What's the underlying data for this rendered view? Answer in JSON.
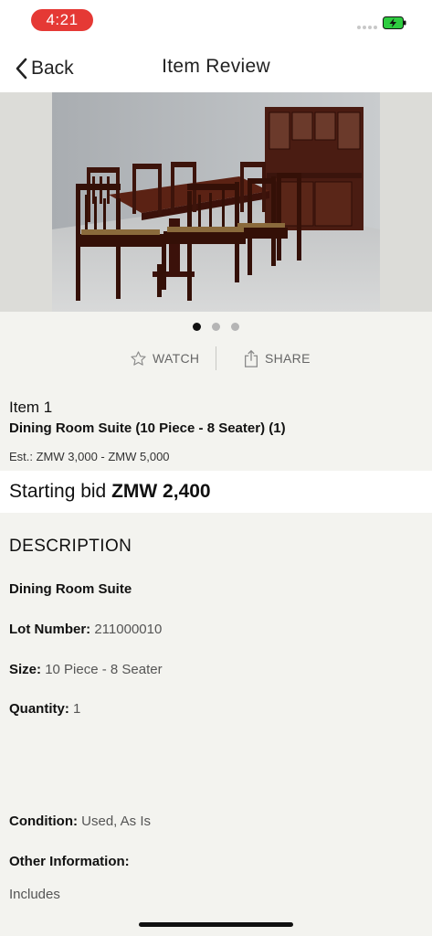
{
  "status_bar": {
    "time": "4:21"
  },
  "nav": {
    "back_label": "Back",
    "title": "Item Review"
  },
  "gallery": {
    "page_count": 3,
    "active_index": 0
  },
  "actions": {
    "watch_label": "WATCH",
    "share_label": "SHARE"
  },
  "item": {
    "number": "Item 1",
    "title": "Dining Room Suite (10 Piece - 8 Seater) (1)",
    "estimate": "Est.: ZMW 3,000 - ZMW 5,000"
  },
  "bid": {
    "label": "Starting bid",
    "amount": "ZMW 2,400"
  },
  "description": {
    "heading": "DESCRIPTION",
    "name": "Dining Room Suite",
    "lot_label": "Lot Number:",
    "lot_value": "211000010",
    "size_label": "Size:",
    "size_value": "10 Piece - 8 Seater",
    "quantity_label": "Quantity:",
    "quantity_value": "1",
    "condition_label": "Condition:",
    "condition_value": "Used, As Is",
    "other_label": "Other Information:",
    "includes": "Includes"
  },
  "colors": {
    "status_pill": "#e53935",
    "battery": "#2ecc40",
    "background": "#f3f3ef"
  }
}
